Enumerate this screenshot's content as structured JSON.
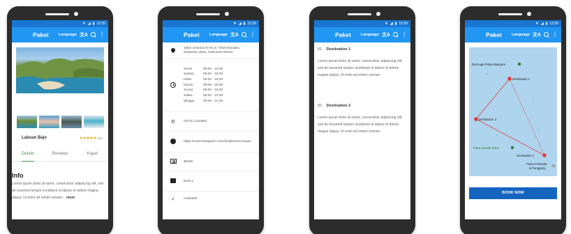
{
  "status_bar": {
    "time": "12:30"
  },
  "app_bar": {
    "title": "Paket",
    "language_label": "Language",
    "language_icon": "translate-icon"
  },
  "screen1": {
    "place_name": "Labuan Bajo",
    "rating_stars": "★★★★★",
    "rating_count": "(24)",
    "tabs": [
      "Details",
      "Reviews",
      "Kapal"
    ],
    "info_title": "Info",
    "info_text": "Lorem ipsum dolor sit amet, consectetur adipiscing elit, sed do eiusmod tempor incididunt ut labore et dolore magna aliqua. Ut enim ad minim veniam...",
    "more_label": "more"
  },
  "screen2": {
    "address": "Jalan Sesama III No.5, Teluk Manado, Sulawesi Utara, Indonesia 55223",
    "hours": [
      {
        "day": "Senin",
        "time": "09:00 - 18:00"
      },
      {
        "day": "Selasa",
        "time": "09:00 - 18:00"
      },
      {
        "day": "Rabu",
        "time": "09:00 - 18:00"
      },
      {
        "day": "Kamis",
        "time": "09:00 - 18:00"
      },
      {
        "day": "Jumat",
        "time": "09:00 - 18:00"
      },
      {
        "day": "Sabtu",
        "time": "09:00 - 21:00"
      },
      {
        "day": "Minggu",
        "time": "09:00 - 21:00"
      }
    ],
    "phone": "(0274) 1234567",
    "website": "https://www.instagram.com/sinlyitomemosque",
    "price": "$2500",
    "boat": "Boat 1",
    "availability": "Available"
  },
  "screen3": {
    "destinations": [
      {
        "number": "01",
        "name": "Destination 1",
        "text": "Lorem ipsum dolor sit amet, consectetur adipiscing elit, sed do eiusmod tempor incididunt ut labore et dolore magna aliqua. Ut enim ad minim veniam."
      },
      {
        "number": "02",
        "name": "Destination 2",
        "text": "Lorem ipsum dolor sit amet, consectetur adipiscing elit, sed do eiusmod tempor incididunt ut labore et dolore magna aliqua. Ut enim ad minim veniam."
      }
    ]
  },
  "screen4": {
    "map_labels": {
      "dermaga": "Dermaga Pulau Mangare",
      "dest1": "Destination 1",
      "dest2": "Destination 2",
      "dest3": "Destination 3",
      "semak": "Pulau Semak Daun",
      "pramuka": "Pulau Pramuka",
      "panggang": "& Panggang"
    },
    "book_label": "BOOK NOW"
  },
  "colors": {
    "primary": "#2196f3",
    "status": "#1976d2",
    "button": "#1565c0",
    "tab_active": "#4a9a4a",
    "star": "#f2a100"
  }
}
